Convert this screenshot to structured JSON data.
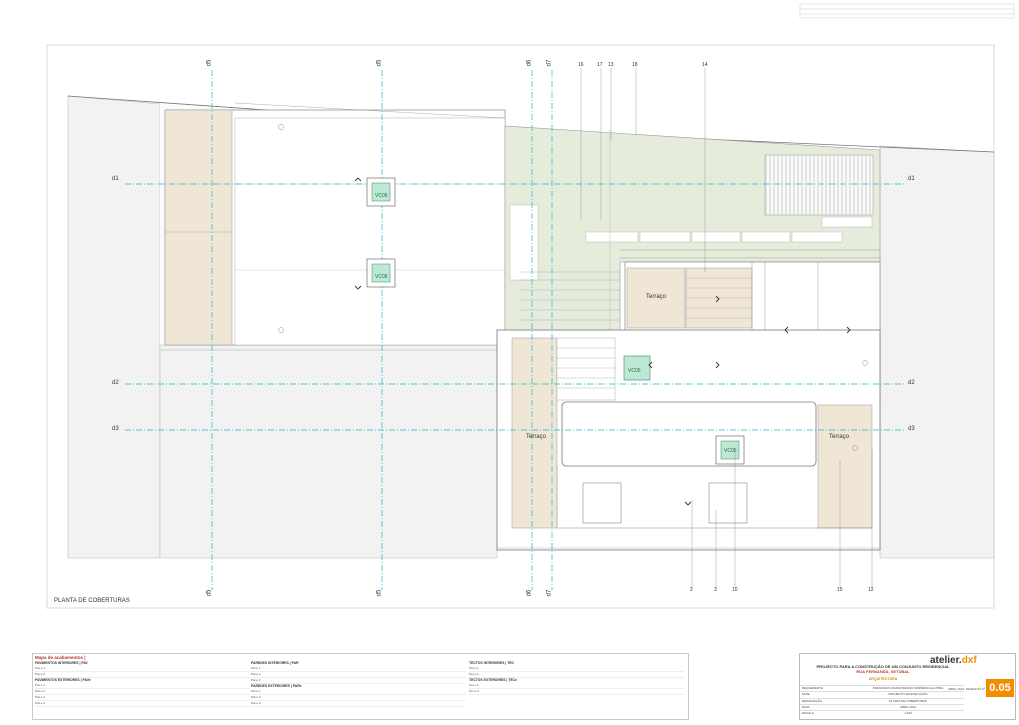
{
  "drawing": {
    "title": "PLANTA DE COBERTURAS",
    "axes_top": [
      "d5",
      "d5",
      "d6",
      "d7"
    ],
    "axes_bottom": [
      "d5",
      "d5",
      "d6",
      "d7"
    ],
    "axes_left": [
      "d1",
      "d2",
      "d3"
    ],
    "axes_right": [
      "d1",
      "d2",
      "d3"
    ],
    "callouts_top": [
      "16",
      "17",
      "13",
      "18",
      "14"
    ],
    "callouts_bottom": [
      "2",
      "3",
      "10",
      "15",
      "12"
    ],
    "rooflights": [
      "VC06",
      "VC06",
      "VC05",
      "VC05"
    ],
    "terraces": [
      "Terraço",
      "Terraço",
      "Terraço"
    ],
    "colors": {
      "fill_green": "#e6ecdc",
      "fill_beige": "#efe6d6",
      "axis_cyan": "#1fb8c7",
      "hatch": "#e0e0e0"
    }
  },
  "schedule": {
    "title": "Mapa de acabamentos |",
    "columns": [
      {
        "header": "PAVIMENTOS INTERIORES | PAV",
        "rows": [
          "Pav.p.1",
          "Pav.p.2"
        ],
        "header2": "PAVIMENTOS EXTERIORES | PAVe",
        "rows2": [
          "Pav.e.1",
          "Pav.e.2",
          "Pav.e.3",
          "Pav.e.4"
        ]
      },
      {
        "header": "PAREDES INTERIORES | PAR",
        "rows": [
          "Par.p.1",
          "Par.p.2",
          "Par.p.3"
        ],
        "header2": "PAREDES EXTERIORES | PARe",
        "rows2": [
          "Par.e.1",
          "Par.e.2",
          "Par.e.3"
        ]
      },
      {
        "header": "TECTOS INTERIORES | TEC",
        "rows": [
          "Tec.p.1",
          "Tec.p.2"
        ],
        "header2": "TECTOS EXTERIORES | TECe",
        "rows2": [
          "Tec.e.1",
          "Tec.e.2"
        ]
      }
    ]
  },
  "titleblock": {
    "project": "PROJECTO PARA A CONSTRUÇÃO DE UM CONJUNTO RESIDENCIAL",
    "location": "RUA FERNANDA, SETÚBAL",
    "specialty": "ARQUITECTURA",
    "rows": [
      {
        "k": "REQUERENTE",
        "v": "FRANCISCO FRANCISMANO SIMPÉRIO ALCATRA"
      },
      {
        "k": "FASE",
        "v": "PROJECTO DE EXECUÇÃO"
      },
      {
        "k": "DESIGNAÇÃO",
        "v": "PLANTA DE COBERTURAS"
      },
      {
        "k": "DATA",
        "v": "ABRIL 2024"
      },
      {
        "k": "ESCALA",
        "v": "1:100"
      }
    ],
    "logo_main": "atelier.",
    "logo_accent": "dxf",
    "sheet_number": "0.05",
    "sheet_label": "DESENHO Nº",
    "sheet_date": "ABRIL 2024"
  }
}
